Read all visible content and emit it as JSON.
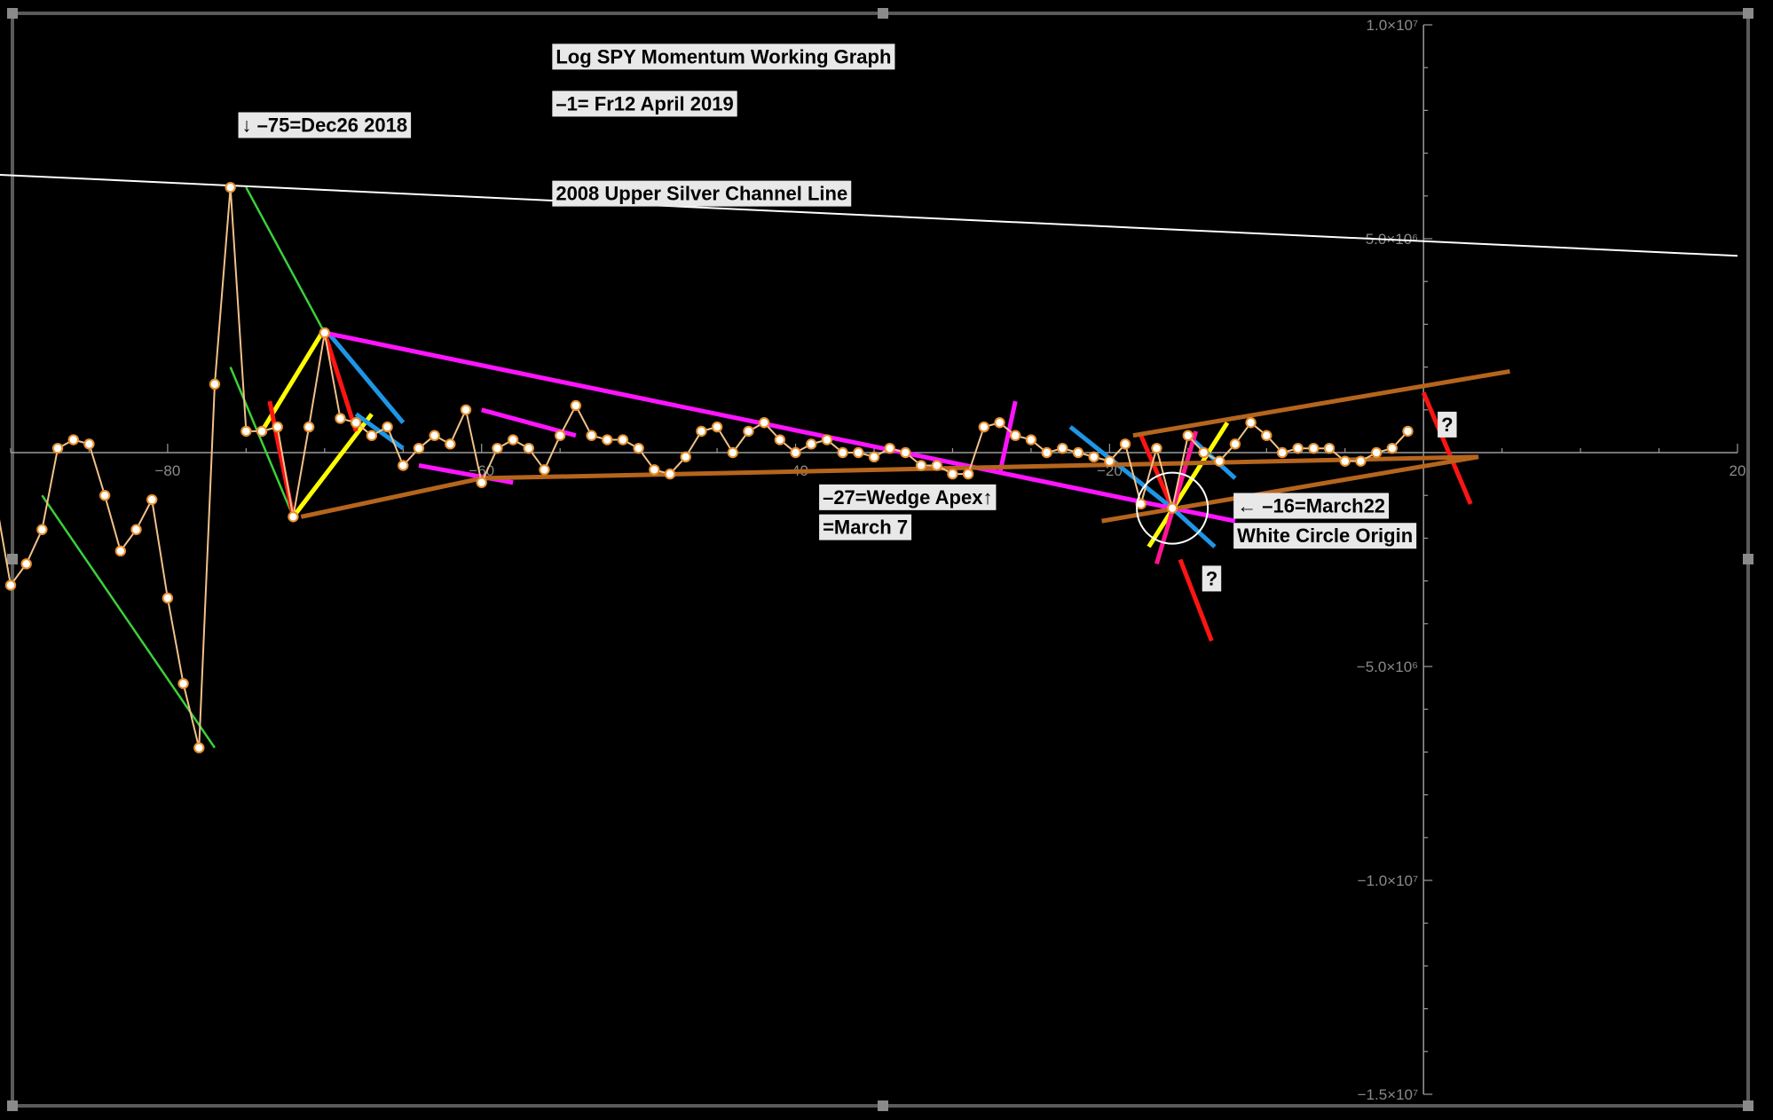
{
  "chart_data": {
    "type": "line",
    "title": "Log SPY Momentum Working Graph",
    "subtitle": "–1= Fr12 April 2019",
    "xlim": [
      -90,
      20
    ],
    "ylim": [
      -15000000,
      10000000
    ],
    "grid": false,
    "x_ticks": [
      {
        "value": -80,
        "label": "−80"
      },
      {
        "value": -60,
        "label": "−60"
      },
      {
        "value": -40,
        "label": "−40"
      },
      {
        "value": -20,
        "label": "−20"
      },
      {
        "value": 20,
        "label": "20"
      }
    ],
    "y_ticks": [
      {
        "value": 10000000,
        "label": "1.0×10⁷"
      },
      {
        "value": 5000000,
        "label": "5.0×10⁶"
      },
      {
        "value": -5000000,
        "label": "−5.0×10⁶"
      },
      {
        "value": -10000000,
        "label": "−1.0×10⁷"
      },
      {
        "value": -15000000,
        "label": "−1.5×10⁷"
      }
    ],
    "series": [
      {
        "color": "#f2c18a",
        "x": [
          -91,
          -90,
          -89,
          -88,
          -87,
          -86,
          -85,
          -84,
          -83,
          -82,
          -81,
          -80,
          -79,
          -78,
          -77,
          -76,
          -75,
          -74,
          -73,
          -72,
          -71,
          -70,
          -69,
          -68,
          -67,
          -66,
          -65,
          -64,
          -63,
          -62,
          -61,
          -60,
          -59,
          -58,
          -57,
          -56,
          -55,
          -54,
          -53,
          -52,
          -51,
          -50,
          -49,
          -48,
          -47,
          -46,
          -45,
          -44,
          -43,
          -42,
          -41,
          -40,
          -39,
          -38,
          -37,
          -36,
          -35,
          -34,
          -33,
          -32,
          -31,
          -30,
          -29,
          -28,
          -27,
          -26,
          -25,
          -24,
          -23,
          -22,
          -21,
          -20,
          -19,
          -18,
          -17,
          -16,
          -15,
          -14,
          -13,
          -12,
          -11,
          -10,
          -9,
          -8,
          -7,
          -6,
          -5,
          -4,
          -3,
          -2,
          -1
        ],
        "y": [
          -1000000,
          -3100000,
          -2600000,
          -1800000,
          100000,
          300000,
          200000,
          -1000000,
          -2300000,
          -1800000,
          -1100000,
          -3400000,
          -5400000,
          -6900000,
          1600000,
          6200000,
          500000,
          500000,
          600000,
          -1500000,
          600000,
          2800000,
          800000,
          700000,
          400000,
          600000,
          -300000,
          100000,
          400000,
          200000,
          1000000,
          -700000,
          100000,
          300000,
          100000,
          -400000,
          400000,
          1100000,
          400000,
          300000,
          300000,
          100000,
          -400000,
          -500000,
          -100000,
          500000,
          600000,
          0,
          500000,
          700000,
          300000,
          0,
          200000,
          300000,
          0,
          0,
          -100000,
          100000,
          0,
          -300000,
          -300000,
          -500000,
          -500000,
          600000,
          700000,
          400000,
          300000,
          0,
          100000,
          0,
          -100000,
          -200000,
          200000,
          -1200000,
          100000,
          -1300000,
          400000,
          0,
          -200000,
          200000,
          700000,
          400000,
          0,
          100000,
          100000,
          100000,
          -200000,
          -200000,
          0,
          100000,
          500000
        ]
      }
    ],
    "reference_lines": [
      {
        "name": "silver-channel-line",
        "color": "#ffffff",
        "points": [
          [
            -91,
            6500000
          ],
          [
            20,
            4600000
          ]
        ]
      },
      {
        "name": "green-line-1",
        "color": "#3ad13a",
        "points": [
          [
            -88,
            -1000000
          ],
          [
            -77,
            -6900000
          ]
        ]
      },
      {
        "name": "green-line-2",
        "color": "#3ad13a",
        "points": [
          [
            -76,
            2000000
          ],
          [
            -72,
            -1500000
          ]
        ]
      },
      {
        "name": "green-line-3",
        "color": "#3ad13a",
        "points": [
          [
            -75,
            6200000
          ],
          [
            -70,
            2800000
          ]
        ]
      },
      {
        "name": "yellow-line-1",
        "color": "#ffff00",
        "points": [
          [
            -74,
            500000
          ],
          [
            -70,
            2900000
          ]
        ]
      },
      {
        "name": "yellow-line-2",
        "color": "#ffff00",
        "points": [
          [
            -72,
            -1500000
          ],
          [
            -67,
            900000
          ]
        ]
      },
      {
        "name": "yellow-line-3",
        "color": "#ffff00",
        "points": [
          [
            -17.5,
            -2200000
          ],
          [
            -12.5,
            700000
          ]
        ]
      },
      {
        "name": "red-line-1",
        "color": "#ff1414",
        "points": [
          [
            -73.5,
            1200000
          ],
          [
            -72,
            -1500000
          ]
        ]
      },
      {
        "name": "red-line-2",
        "color": "#ff1414",
        "points": [
          [
            -70,
            2800000
          ],
          [
            -68,
            500000
          ]
        ]
      },
      {
        "name": "red-line-3",
        "color": "#ff1414",
        "points": [
          [
            -18,
            400000
          ],
          [
            -16,
            -1300000
          ]
        ]
      },
      {
        "name": "red-line-4",
        "color": "#ff1414",
        "points": [
          [
            -15.5,
            -2500000
          ],
          [
            -13.5,
            -4400000
          ]
        ]
      },
      {
        "name": "red-line-5",
        "color": "#ff1414",
        "points": [
          [
            0,
            1400000
          ],
          [
            3,
            -1200000
          ]
        ]
      },
      {
        "name": "blue-line-1",
        "color": "#1e96e6",
        "points": [
          [
            -70,
            2900000
          ],
          [
            -65,
            700000
          ]
        ]
      },
      {
        "name": "blue-line-2",
        "color": "#1e96e6",
        "points": [
          [
            -68,
            900000
          ],
          [
            -65,
            100000
          ]
        ]
      },
      {
        "name": "blue-line-3",
        "color": "#1e96e6",
        "points": [
          [
            -22.5,
            600000
          ],
          [
            -16,
            -1300000
          ]
        ]
      },
      {
        "name": "blue-line-4",
        "color": "#1e96e6",
        "points": [
          [
            -16,
            -1300000
          ],
          [
            -13.3,
            -2200000
          ]
        ]
      },
      {
        "name": "blue-line-5",
        "color": "#1e96e6",
        "points": [
          [
            -15,
            400000
          ],
          [
            -12,
            -600000
          ]
        ]
      },
      {
        "name": "magenta-line-1",
        "color": "#ff14ff",
        "points": [
          [
            -70,
            2800000
          ],
          [
            -16,
            -1300000
          ]
        ]
      },
      {
        "name": "magenta-line-2",
        "color": "#ff14ff",
        "points": [
          [
            -64,
            -300000
          ],
          [
            -58,
            -700000
          ]
        ]
      },
      {
        "name": "magenta-line-3",
        "color": "#ff14ff",
        "points": [
          [
            -60,
            1000000
          ],
          [
            -54,
            400000
          ]
        ]
      },
      {
        "name": "magenta-line-4",
        "color": "#ff14ff",
        "points": [
          [
            -16,
            -1300000
          ],
          [
            -12,
            -1600000
          ]
        ]
      },
      {
        "name": "magenta-line-5",
        "color": "#ff14ff",
        "points": [
          [
            -27,
            -500000
          ],
          [
            -26,
            1200000
          ]
        ]
      },
      {
        "name": "pink-line-1",
        "color": "#ff1493",
        "points": [
          [
            -17,
            -2600000
          ],
          [
            -14.5,
            500000
          ]
        ]
      },
      {
        "name": "brown-line-1",
        "color": "#b5651d",
        "points": [
          [
            -71.5,
            -1500000
          ],
          [
            -60,
            -600000
          ]
        ]
      },
      {
        "name": "brown-line-2",
        "color": "#b5651d",
        "points": [
          [
            -60,
            -600000
          ],
          [
            3.5,
            -100000
          ]
        ]
      },
      {
        "name": "brown-line-3",
        "color": "#b5651d",
        "points": [
          [
            -20.5,
            -1600000
          ],
          [
            3.5,
            -100000
          ]
        ]
      },
      {
        "name": "brown-line-4",
        "color": "#b5651d",
        "points": [
          [
            -18.5,
            400000
          ],
          [
            5.5,
            1900000
          ]
        ]
      }
    ],
    "white_circle": {
      "x": -16,
      "y": -1300000,
      "radius": 40
    },
    "annotations": [
      {
        "name": "annotation-title",
        "text": "Log SPY Momentum Working Graph",
        "x": -55.5,
        "y": 9100000
      },
      {
        "name": "annotation-subtitle",
        "text": "–1= Fr12 April 2019",
        "x": -55.5,
        "y": 8000000
      },
      {
        "name": "annotation-dec26",
        "text": "↓ –75=Dec26 2018",
        "x": -75.5,
        "y": 7500000
      },
      {
        "name": "annotation-silver-channel",
        "text": "2008 Upper Silver Channel Line",
        "x": -55.5,
        "y": 5900000
      },
      {
        "name": "annotation-wedge-apex-1",
        "text": "–27=Wedge Apex↑",
        "x": -38.5,
        "y": -1200000
      },
      {
        "name": "annotation-wedge-apex-2",
        "text": "=March 7",
        "x": -38.5,
        "y": -1900000
      },
      {
        "name": "annotation-march22",
        "text": "← –16=March22",
        "x": -12.1,
        "y": -1400000
      },
      {
        "name": "annotation-white-circle-origin",
        "text": "White Circle Origin",
        "x": -12.1,
        "y": -2100000
      },
      {
        "name": "annotation-question-1",
        "text": "?",
        "x": -14.1,
        "y": -3100000
      },
      {
        "name": "annotation-question-2",
        "text": "?",
        "x": 0.9,
        "y": 500000
      }
    ]
  }
}
